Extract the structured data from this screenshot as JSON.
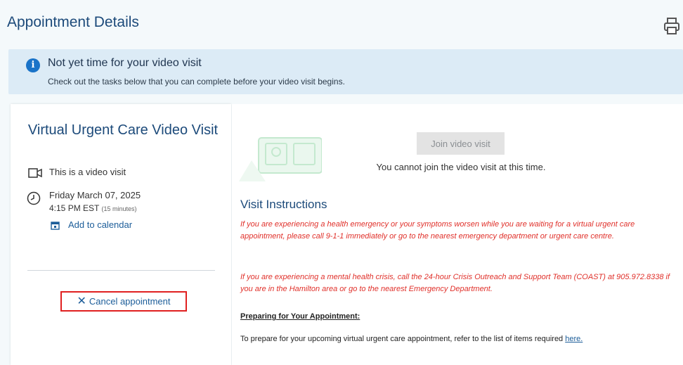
{
  "header": {
    "title": "Appointment Details",
    "print_icon": "printer-icon"
  },
  "banner": {
    "icon": "info-icon",
    "icon_glyph": "i",
    "title": "Not yet time for your video visit",
    "text": "Check out the tasks below that you can complete before your video visit begins."
  },
  "appointment": {
    "title": "Virtual Urgent Care Video Visit",
    "video_label": "This is a video visit",
    "date": "Friday March 07, 2025",
    "time": "4:15 PM EST",
    "duration": "(15 minutes)",
    "add_to_calendar": "Add to calendar",
    "cancel_icon_glyph": "✕",
    "cancel_label": "Cancel appointment"
  },
  "video": {
    "join_label": "Join video visit",
    "join_note": "You cannot join the video visit at this time."
  },
  "instructions": {
    "title": "Visit Instructions",
    "para1": "If you are experiencing a health emergency or your symptoms worsen while you are waiting for a virtual urgent care appointment, please call 9-1-1 immediately or go to the nearest emergency department or urgent care centre.",
    "para2": "If you are experiencing a mental health crisis, call the 24-hour Crisis Outreach and Support Team (COAST) at 905.972.8338 if you are in the Hamilton area or go to the nearest Emergency Department.",
    "prep_title": "Preparing for Your Appointment:",
    "prep_text": "To prepare for your upcoming virtual urgent care appointment, refer to the list of items required ",
    "prep_link": "here."
  },
  "colors": {
    "accent": "#1c4a7a",
    "link": "#1c5d99",
    "banner_bg": "#dcebf6",
    "warning_text": "#e0302a",
    "highlight_border": "#e02020"
  }
}
